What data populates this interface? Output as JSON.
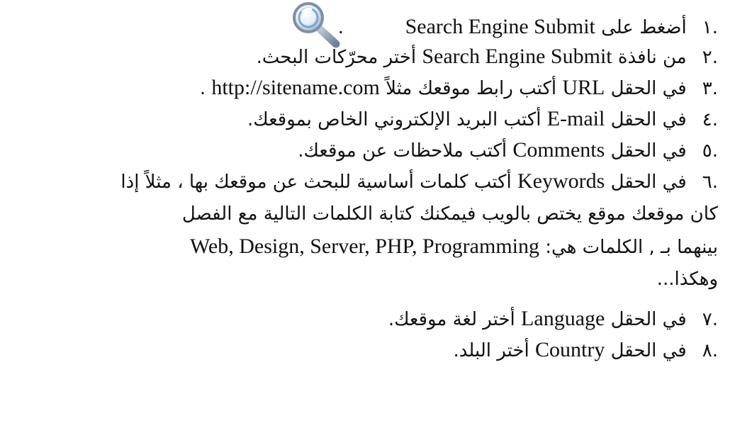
{
  "items": [
    {
      "num": ".١",
      "pre": "أضغط على",
      "en": "Search Engine Submit",
      "post": "."
    },
    {
      "num": ".٢",
      "pre": "من نافذة",
      "en": "Search Engine Submit",
      "post": "أختر محرّكات البحث."
    },
    {
      "num": ".٣",
      "pre": "في الحقل",
      "en": "URL",
      "post": "أكتب رابط موقعك مثلاً",
      "en2": "http://sitename.com",
      "post2": "."
    },
    {
      "num": ".٤",
      "pre": "في الحقل",
      "en": "E-mail",
      "post": "أكتب البريد الإلكتروني الخاص بموقعك."
    },
    {
      "num": ".٥",
      "pre": "في الحقل",
      "en": "Comments",
      "post": "أكتب ملاحظات عن موقعك."
    },
    {
      "num": ".٦",
      "pre": "في الحقل",
      "en": "Keywords",
      "post": "أكتب كلمات أساسية للبحث عن موقعك بها ، مثلاً إذا",
      "line2": "كان موقعك موقع يختص بالويب فيمكنك كتابة الكلمات التالية مع الفصل",
      "line3_pre": "بينهما بـ , الكلمات هي:",
      "line3_en": "Web, Design, Server, PHP, Programming",
      "line4": "وهكذا..."
    },
    {
      "num": ".٧",
      "pre": "في الحقل",
      "en": "Language",
      "post": "أختر لغة موقعك."
    },
    {
      "num": ".٨",
      "pre": "في الحقل",
      "en": "Country",
      "post": "أختر البلد."
    }
  ]
}
